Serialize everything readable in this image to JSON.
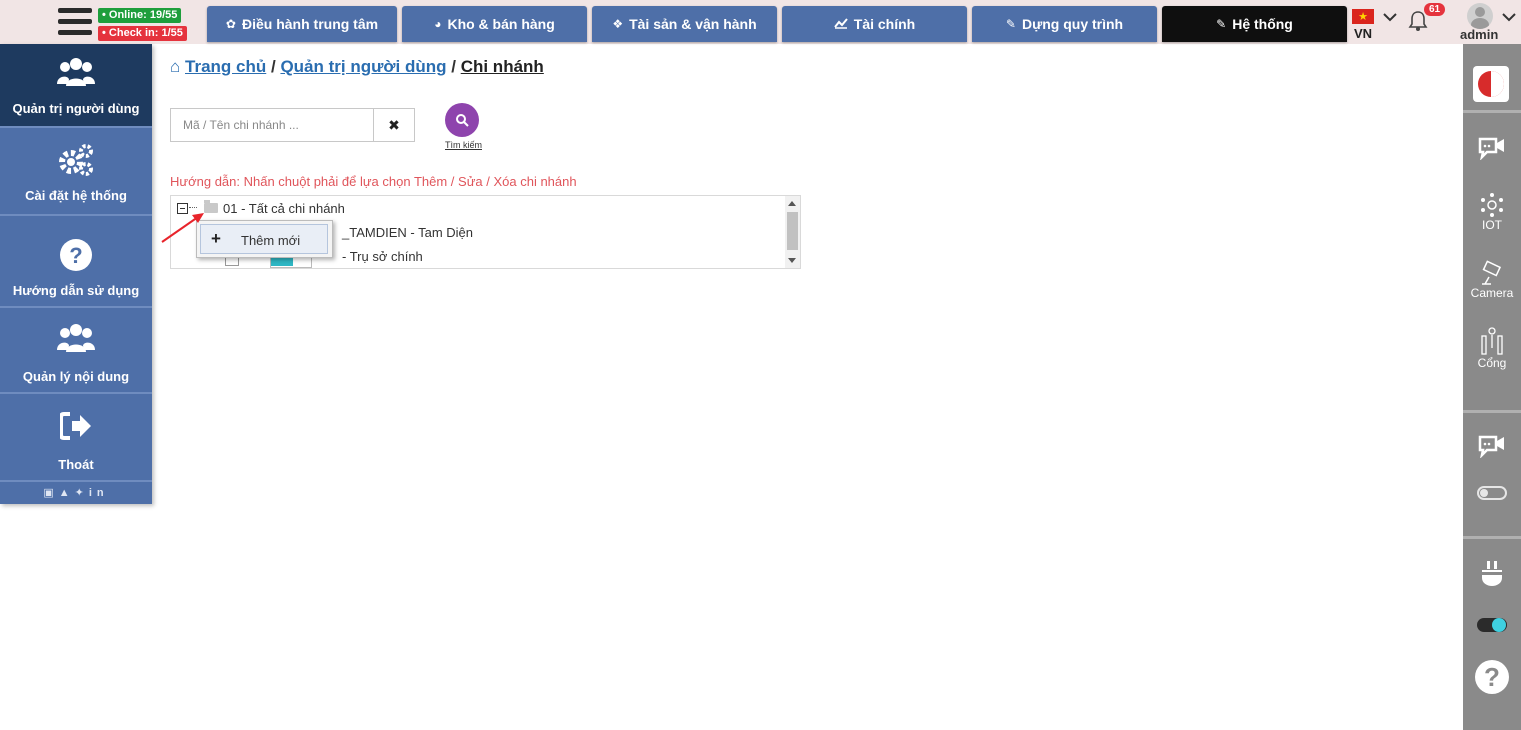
{
  "topbar": {
    "status_online": "• Online: 19/55",
    "status_checkin": "• Check in: 1/55",
    "tabs": [
      {
        "label": "Điều hành trung tâm",
        "icon": "gear-icon"
      },
      {
        "label": "Kho & bán hàng",
        "icon": "pie-chart-icon"
      },
      {
        "label": "Tài sản & vận hành",
        "icon": "cubes-icon"
      },
      {
        "label": "Tài chính",
        "icon": "line-chart-icon"
      },
      {
        "label": "Dựng quy trình",
        "icon": "edit-icon"
      },
      {
        "label": "Hệ thống",
        "icon": "edit-icon"
      }
    ],
    "language": "VN",
    "notification_count": "61",
    "username": "admin"
  },
  "sidebar": {
    "items": [
      {
        "label": "Quản trị người dùng",
        "icon": "users-icon"
      },
      {
        "label": "Cài đặt hệ thống",
        "icon": "gears-icon"
      },
      {
        "label": "Hướng dẫn sử dụng",
        "icon": "question-circle-icon"
      },
      {
        "label": "Quản lý nội dung",
        "icon": "users-icon"
      },
      {
        "label": "Thoát",
        "icon": "sign-out-icon"
      }
    ]
  },
  "breadcrumb": {
    "home": "Trang chủ",
    "parent": "Quản trị người dùng",
    "current": "Chi nhánh",
    "separator": "/"
  },
  "search": {
    "placeholder": "Mã / Tên chi nhánh ...",
    "clear_label": "✖",
    "button_label": "Tìm kiếm"
  },
  "guide_text": "Hướng dẫn: Nhấn chuột phải để lựa chọn Thêm / Sửa / Xóa chi nhánh",
  "tree": {
    "root": "01 - Tất cả chi nhánh",
    "children": [
      "_TAMDIEN - Tam Diện",
      "- Trụ sở chính"
    ]
  },
  "context_menu": {
    "add_label": "Thêm mới",
    "add_icon": "+"
  },
  "right_bar": {
    "iot_label": "IOT",
    "camera_label": "Camera",
    "gate_label": "Cổng",
    "help_label": "?"
  },
  "colors": {
    "tab_bg": "#4e6fa8",
    "tab_active_bg": "#0f0f0f",
    "sidebar_active_bg": "#1e3a5f",
    "search_button": "#8e44ad",
    "guide_text": "#e0555b",
    "online_badge": "#1e9e3c",
    "checkin_badge": "#e5333d"
  }
}
